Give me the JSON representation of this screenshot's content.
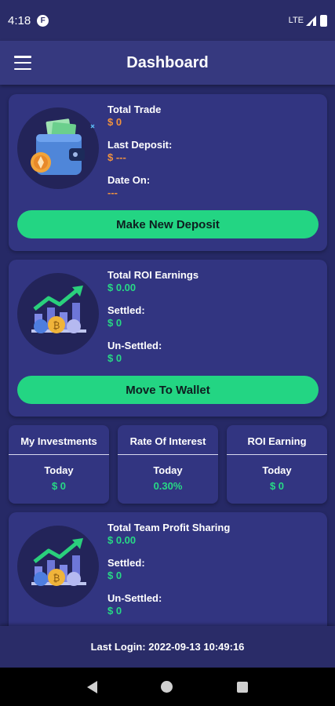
{
  "status_bar": {
    "time": "4:18",
    "notification_glyph": "F",
    "network": "LTE"
  },
  "app_bar": {
    "title": "Dashboard",
    "menu_icon": "hamburger-menu-icon"
  },
  "trade_card": {
    "icon": "wallet-icon",
    "total_trade_label": "Total Trade",
    "total_trade_value": "$ 0",
    "last_deposit_label": "Last Deposit:",
    "last_deposit_value": "$ ---",
    "date_on_label": "Date On:",
    "date_on_value": "---",
    "button_label": "Make New Deposit"
  },
  "roi_card": {
    "icon": "growth-chart-icon",
    "title_label": "Total ROI Earnings",
    "title_value": "$ 0.00",
    "settled_label": "Settled:",
    "settled_value": "$ 0",
    "unsettled_label": "Un-Settled:",
    "unsettled_value": "$ 0",
    "button_label": "Move To Wallet"
  },
  "stats": [
    {
      "title": "My Investments",
      "subtitle": "Today",
      "value": "$ 0"
    },
    {
      "title": "Rate Of Interest",
      "subtitle": "Today",
      "value": "0.30%"
    },
    {
      "title": "ROI Earning",
      "subtitle": "Today",
      "value": "$ 0"
    }
  ],
  "team_card": {
    "icon": "growth-chart-icon",
    "title_label": "Total Team Profit Sharing",
    "title_value": "$ 0.00",
    "settled_label": "Settled:",
    "settled_value": "$ 0",
    "unsettled_label": "Un-Settled:",
    "unsettled_value": "$ 0"
  },
  "footer": {
    "last_login": "Last Login: 2022-09-13 10:49:16"
  },
  "colors": {
    "background": "#262966",
    "card": "#323581",
    "accent_green": "#23d583",
    "accent_orange": "#f0923e"
  }
}
